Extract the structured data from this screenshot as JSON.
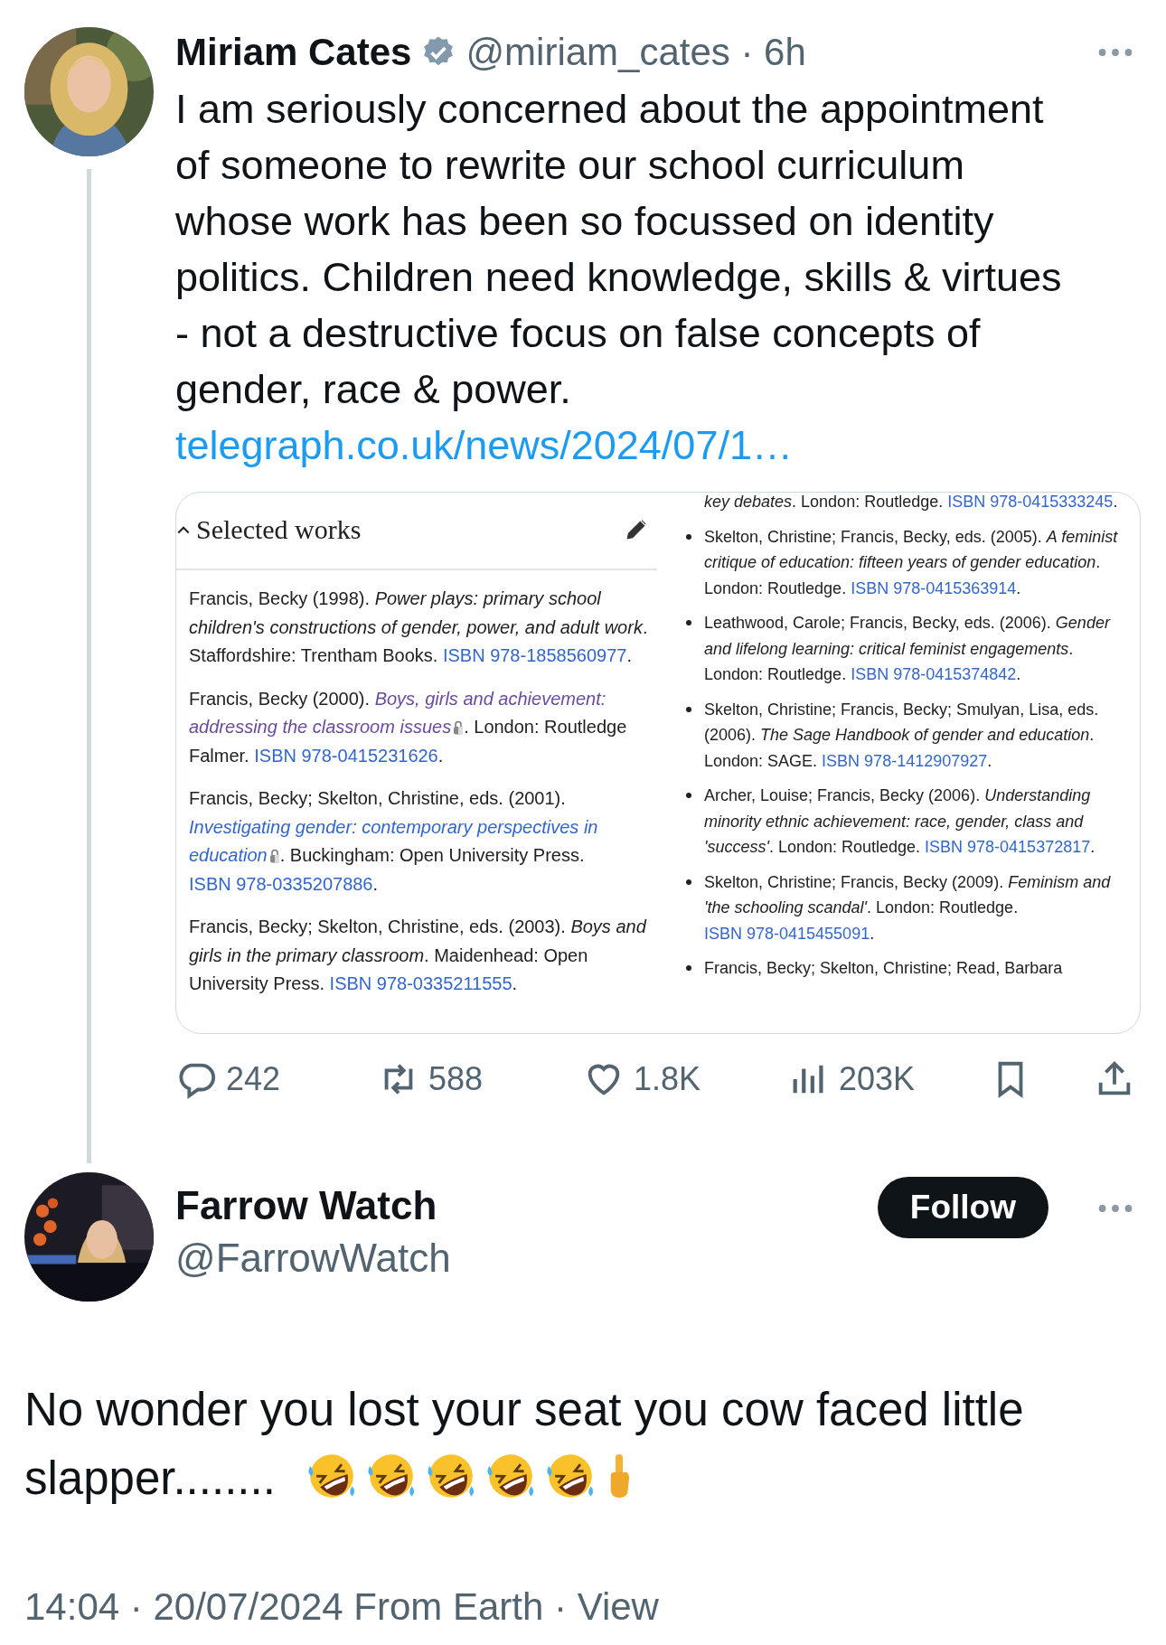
{
  "tweet": {
    "author": {
      "name": "Miriam Cates",
      "verified": true,
      "meta": "@miriam_cates · 6h"
    },
    "text": "I am seriously concerned about the appointment of someone to rewrite our school curriculum whose work has been so focussed on identity politics. Children need knowledge, skills & virtues - not a destructive focus on false concepts of gender, race & power.",
    "link": "telegraph.co.uk/news/2024/07/1…",
    "image": {
      "header": "Selected works",
      "left": [
        {
          "segments": [
            {
              "kind": "plain",
              "text": "Francis, Becky (1998). "
            },
            {
              "kind": "italic",
              "text": "Power plays: primary school children's constructions of gender, power, and adult work"
            },
            {
              "kind": "plain",
              "text": ". Staffordshire: Trentham Books. "
            },
            {
              "kind": "link",
              "text": "ISBN 978-1858560977"
            },
            {
              "kind": "plain",
              "text": "."
            }
          ]
        },
        {
          "segments": [
            {
              "kind": "plain",
              "text": "Francis, Becky (2000). "
            },
            {
              "kind": "visited",
              "text": "Boys, girls and achievement:"
            },
            {
              "kind": "space"
            },
            {
              "kind": "visited",
              "text": "addressing the classroom issues"
            },
            {
              "kind": "lock"
            },
            {
              "kind": "plain",
              "text": ". London: Routledge Falmer. "
            },
            {
              "kind": "link",
              "text": "ISBN 978-0415231626"
            },
            {
              "kind": "plain",
              "text": "."
            }
          ]
        },
        {
          "segments": [
            {
              "kind": "plain",
              "text": "Francis, Becky; Skelton, Christine, eds. (2001). "
            },
            {
              "kind": "title_link",
              "text": "Investigating gender: contemporary perspectives in"
            },
            {
              "kind": "space"
            },
            {
              "kind": "title_link",
              "text": "education"
            },
            {
              "kind": "lock"
            },
            {
              "kind": "plain",
              "text": ". Buckingham: Open University Press. "
            },
            {
              "kind": "link",
              "text": "ISBN 978-0335207886"
            },
            {
              "kind": "plain",
              "text": "."
            }
          ]
        },
        {
          "segments": [
            {
              "kind": "plain",
              "text": "Francis, Becky; Skelton, Christine, eds. (2003). "
            },
            {
              "kind": "italic",
              "text": "Boys and girls in the primary classroom"
            },
            {
              "kind": "plain",
              "text": ". Maidenhead: Open University Press. "
            },
            {
              "kind": "link",
              "text": "ISBN 978-0335211555"
            },
            {
              "kind": "plain",
              "text": "."
            }
          ]
        }
      ],
      "right": [
        {
          "bullet": false,
          "segments": [
            {
              "kind": "italic",
              "text": "key debates"
            },
            {
              "kind": "plain",
              "text": ". London: Routledge. "
            },
            {
              "kind": "link",
              "text": "ISBN 978-0415333245"
            },
            {
              "kind": "plain",
              "text": "."
            }
          ]
        },
        {
          "bullet": true,
          "segments": [
            {
              "kind": "plain",
              "text": "Skelton, Christine; Francis, Becky, eds. (2005). "
            },
            {
              "kind": "italic",
              "text": "A feminist critique of education: fifteen years of gender education"
            },
            {
              "kind": "plain",
              "text": ". London: Routledge. "
            },
            {
              "kind": "link",
              "text": "ISBN 978-0415363914"
            },
            {
              "kind": "plain",
              "text": "."
            }
          ]
        },
        {
          "bullet": true,
          "segments": [
            {
              "kind": "plain",
              "text": "Leathwood, Carole; Francis, Becky, eds. (2006). "
            },
            {
              "kind": "italic",
              "text": "Gender and lifelong learning: critical feminist engagements"
            },
            {
              "kind": "plain",
              "text": ". London: Routledge. "
            },
            {
              "kind": "link",
              "text": "ISBN 978-0415374842"
            },
            {
              "kind": "plain",
              "text": "."
            }
          ]
        },
        {
          "bullet": true,
          "segments": [
            {
              "kind": "plain",
              "text": "Skelton, Christine; Francis, Becky; Smulyan, Lisa, eds. (2006). "
            },
            {
              "kind": "italic",
              "text": "The Sage Handbook of gender and education"
            },
            {
              "kind": "plain",
              "text": ". London: SAGE. "
            },
            {
              "kind": "link",
              "text": "ISBN 978-1412907927"
            },
            {
              "kind": "plain",
              "text": "."
            }
          ]
        },
        {
          "bullet": true,
          "segments": [
            {
              "kind": "plain",
              "text": "Archer, Louise; Francis, Becky (2006). "
            },
            {
              "kind": "italic",
              "text": "Understanding minority ethnic achievement: race, gender, class and 'success'"
            },
            {
              "kind": "plain",
              "text": ". London: Routledge. "
            },
            {
              "kind": "link",
              "text": "ISBN 978-0415372817"
            },
            {
              "kind": "plain",
              "text": "."
            }
          ]
        },
        {
          "bullet": true,
          "segments": [
            {
              "kind": "plain",
              "text": "Skelton, Christine; Francis, Becky (2009). "
            },
            {
              "kind": "italic",
              "text": "Feminism and 'the schooling scandal'"
            },
            {
              "kind": "plain",
              "text": ". London: Routledge. "
            },
            {
              "kind": "link",
              "text": "ISBN 978-0415455091"
            },
            {
              "kind": "plain",
              "text": "."
            }
          ]
        },
        {
          "bullet": true,
          "segments": [
            {
              "kind": "plain",
              "text": "Francis, Becky; Skelton, Christine; Read, Barbara"
            }
          ]
        }
      ]
    },
    "actions": [
      {
        "kind": "reply",
        "count": "242"
      },
      {
        "kind": "retweet",
        "count": "588"
      },
      {
        "kind": "like",
        "count": "1.8K"
      },
      {
        "kind": "views",
        "count": "203K"
      },
      {
        "kind": "bookmark"
      },
      {
        "kind": "share"
      }
    ]
  },
  "reply": {
    "author": {
      "name": "Farrow Watch",
      "handle": "@FarrowWatch"
    },
    "follow": "Follow",
    "text": "No wonder you lost your seat you cow faced little slapper........",
    "emojis": [
      {
        "kind": "rofl"
      },
      {
        "kind": "rofl"
      },
      {
        "kind": "rofl"
      },
      {
        "kind": "rofl"
      },
      {
        "kind": "rofl"
      },
      {
        "kind": "finger"
      }
    ],
    "timestamp": "14:04 · 20/07/2024 From Earth · View"
  }
}
